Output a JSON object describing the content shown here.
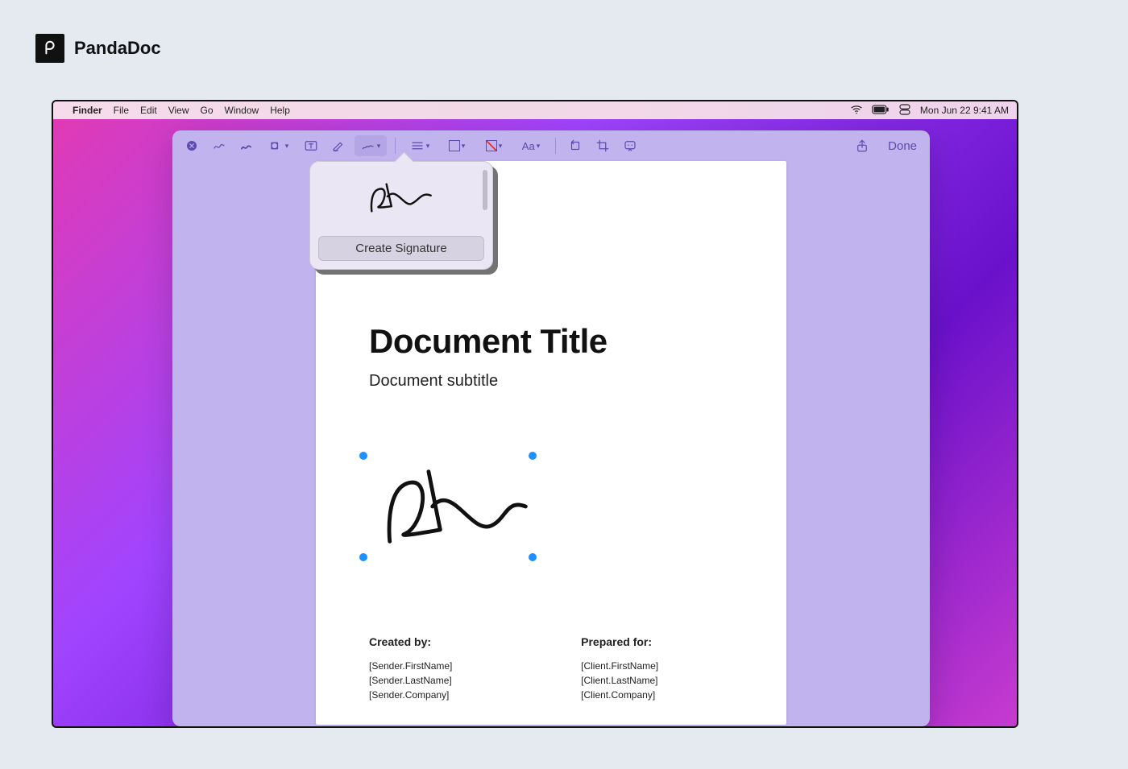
{
  "brand": {
    "name": "PandaDoc",
    "badge_glyph": "pd"
  },
  "menubar": {
    "app": "Finder",
    "items": [
      "File",
      "Edit",
      "View",
      "Go",
      "Window",
      "Help"
    ],
    "datetime": "Mon Jun 22  9:41 AM"
  },
  "toolbar": {
    "done_label": "Done"
  },
  "popover": {
    "button_label": "Create Signature"
  },
  "document": {
    "title": "Document Title",
    "subtitle": "Document subtitle",
    "footer": {
      "created_by_heading": "Created by:",
      "created_by_line1": "[Sender.FirstName] [Sender.LastName]",
      "created_by_line2": "[Sender.Company]",
      "prepared_for_heading": "Prepared for:",
      "prepared_for_line1": "[Client.FirstName] [Client.LastName]",
      "prepared_for_line2": "[Client.Company]"
    }
  }
}
